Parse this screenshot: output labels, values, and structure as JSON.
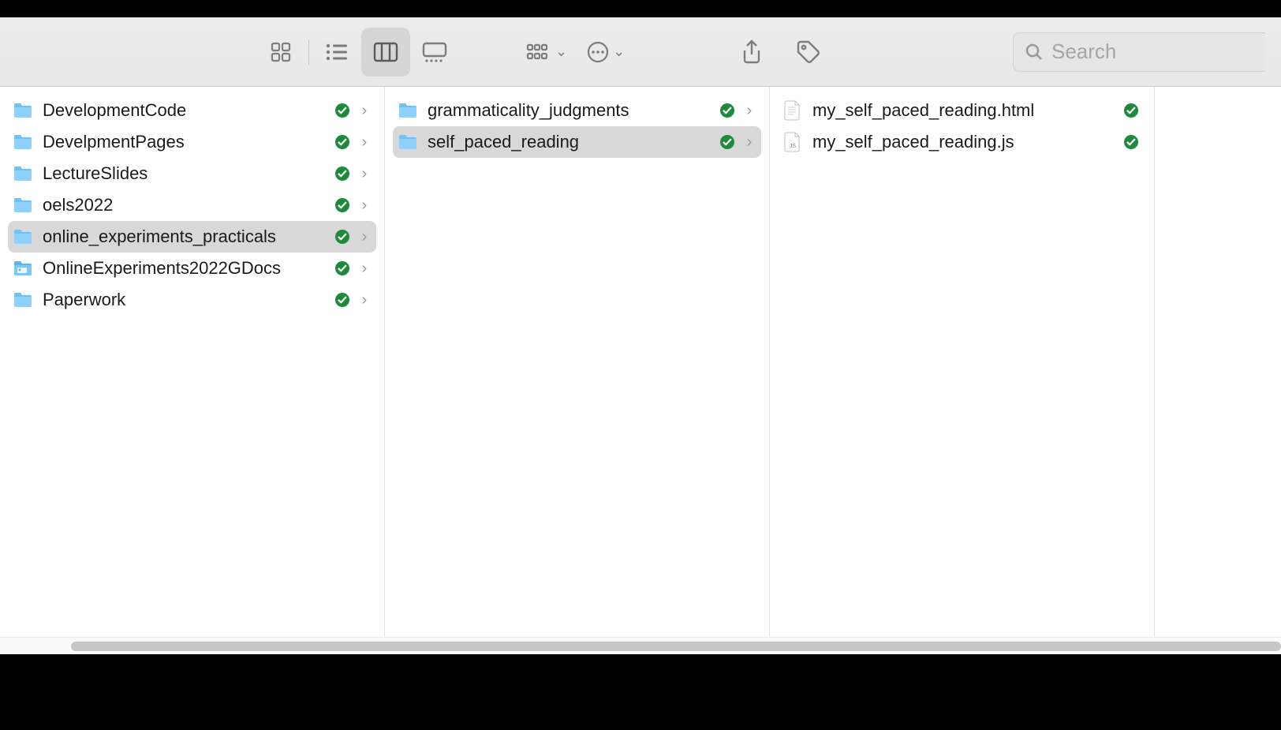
{
  "search": {
    "placeholder": "Search"
  },
  "columns": [
    {
      "items": [
        {
          "name": "DevelopmentCode",
          "type": "folder",
          "synced": true,
          "hasChildren": true,
          "selected": false
        },
        {
          "name": "DevelpmentPages",
          "type": "folder",
          "synced": true,
          "hasChildren": true,
          "selected": false
        },
        {
          "name": "LectureSlides",
          "type": "folder",
          "synced": true,
          "hasChildren": true,
          "selected": false
        },
        {
          "name": "oels2022",
          "type": "folder",
          "synced": true,
          "hasChildren": true,
          "selected": false
        },
        {
          "name": "online_experiments_practicals",
          "type": "folder",
          "synced": true,
          "hasChildren": true,
          "selected": true
        },
        {
          "name": "OnlineExperiments2022GDocs",
          "type": "gfolder",
          "synced": true,
          "hasChildren": true,
          "selected": false
        },
        {
          "name": "Paperwork",
          "type": "folder",
          "synced": true,
          "hasChildren": true,
          "selected": false
        }
      ]
    },
    {
      "items": [
        {
          "name": "grammaticality_judgments",
          "type": "folder",
          "synced": true,
          "hasChildren": true,
          "selected": false
        },
        {
          "name": "self_paced_reading",
          "type": "folder",
          "synced": true,
          "hasChildren": true,
          "selected": true
        }
      ]
    },
    {
      "items": [
        {
          "name": "my_self_paced_reading.html",
          "type": "file",
          "synced": true,
          "hasChildren": false,
          "selected": false
        },
        {
          "name": "my_self_paced_reading.js",
          "type": "file-js",
          "synced": true,
          "hasChildren": false,
          "selected": false
        }
      ]
    }
  ]
}
